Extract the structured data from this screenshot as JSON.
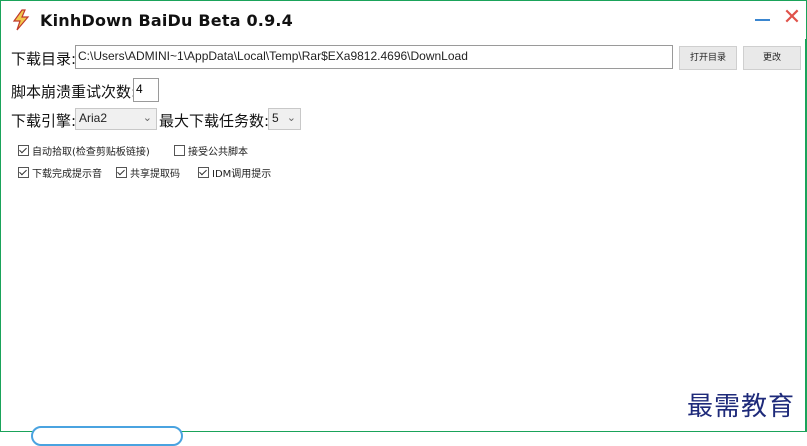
{
  "window": {
    "title": "KinhDown BaiDu Beta 0.9.4",
    "border_color": "#1aa35a",
    "minimize_icon": "minimize-icon",
    "close_icon": "close-icon",
    "close_glyph": "✕"
  },
  "download_dir": {
    "label": "下载目录:",
    "value": "C:\\Users\\ADMINI~1\\AppData\\Local\\Temp\\Rar$EXa9812.4696\\DownLoad",
    "open_button": "打开目录",
    "change_button": "更改"
  },
  "retry": {
    "label": "脚本崩溃重试次数:",
    "value": "4"
  },
  "engine": {
    "label": "下载引擎:",
    "selected": "Aria2",
    "max_tasks_label": "最大下载任务数:",
    "max_tasks_selected": "5"
  },
  "options": [
    {
      "label": "自动拾取(检查剪贴板链接)",
      "checked": true
    },
    {
      "label": "接受公共脚本",
      "checked": false
    },
    {
      "label": "下载完成提示音",
      "checked": true
    },
    {
      "label": "共享提取码",
      "checked": true
    },
    {
      "label": "IDM调用提示",
      "checked": true
    }
  ],
  "watermark": "最需教育"
}
